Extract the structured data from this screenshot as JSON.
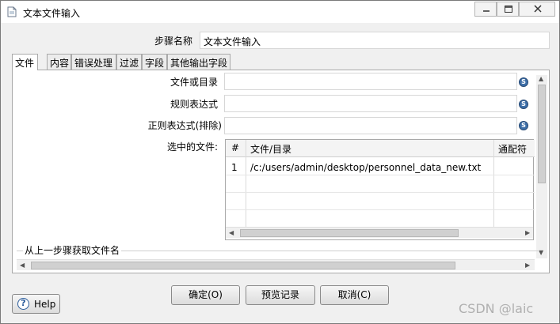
{
  "window": {
    "title": "文本文件输入"
  },
  "step_name": {
    "label": "步骤名称",
    "value": "文本文件输入"
  },
  "tabs": [
    {
      "label": "文件"
    },
    {
      "label": "内容"
    },
    {
      "label": "错误处理"
    },
    {
      "label": "过滤"
    },
    {
      "label": "字段"
    },
    {
      "label": "其他输出字段"
    }
  ],
  "file_tab": {
    "file_or_dir_label": "文件或目录",
    "file_or_dir_value": "",
    "regex_label": "规则表达式",
    "regex_value": "",
    "regex_exclude_label": "正则表达式(排除)",
    "regex_exclude_value": "",
    "selected_files_label": "选中的文件:",
    "variable_icon": "S",
    "grid": {
      "columns": [
        "#",
        "文件/目录",
        "通配符"
      ],
      "rows": [
        {
          "num": "1",
          "path": "/c:/users/admin/desktop/personnel_data_new.txt",
          "wildcard": ""
        }
      ]
    },
    "prev_step_group_label": "从上一步骤获取文件名"
  },
  "buttons": {
    "ok": "确定(O)",
    "preview": "预览记录",
    "cancel": "取消(C)",
    "help": "Help"
  },
  "watermark": "CSDN @laic",
  "colors": {
    "accent": "#2a5b9a",
    "variable_icon": "#3e6fa8"
  }
}
